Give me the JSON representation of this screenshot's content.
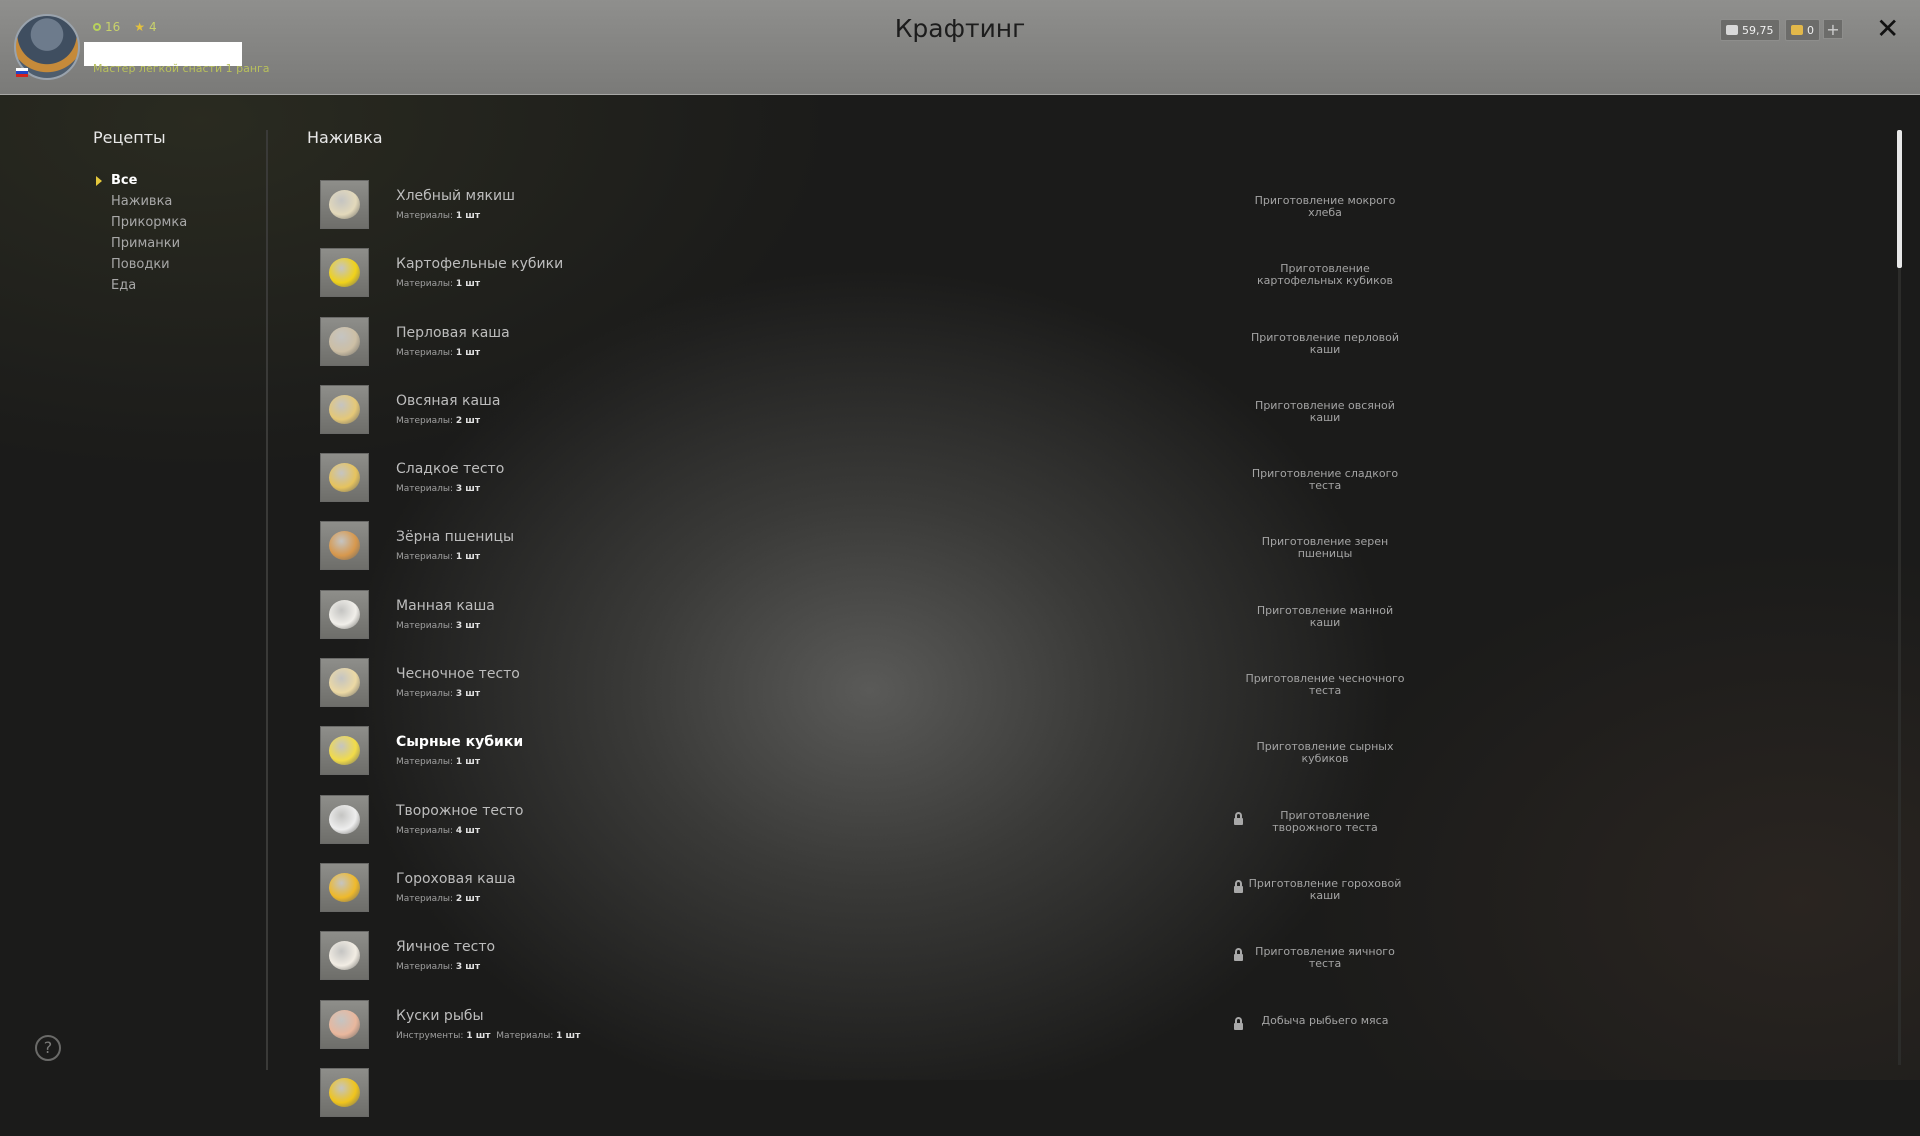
{
  "header": {
    "title": "Крафтинг",
    "level": "16",
    "stars": "4",
    "rank": "Мастер легкой снасти 1 ранга",
    "currency_silver": "59,75",
    "currency_gold": "0",
    "add_label": "+",
    "close_label": "✕"
  },
  "nav": {
    "title": "Рецепты",
    "items": [
      {
        "label": "Все"
      },
      {
        "label": "Наживка"
      },
      {
        "label": "Прикормка"
      },
      {
        "label": "Приманки"
      },
      {
        "label": "Поводки"
      },
      {
        "label": "Еда"
      }
    ]
  },
  "section_title": "Наживка",
  "recipes": [
    {
      "name": "Хлебный мякиш",
      "mat_label": "Материалы:",
      "mat_value": "1 шт",
      "desc": "Приготовление мокрого хлеба",
      "color": "#e3d9bb"
    },
    {
      "name": "Картофельные кубики",
      "mat_label": "Материалы:",
      "mat_value": "1 шт",
      "desc": "Приготовление картофельных кубиков",
      "color": "#f0d21a"
    },
    {
      "name": "Перловая каша",
      "mat_label": "Материалы:",
      "mat_value": "1 шт",
      "desc": "Приготовление перловой каши",
      "color": "#cdbfa5"
    },
    {
      "name": "Овсяная каша",
      "mat_label": "Материалы:",
      "mat_value": "2 шт",
      "desc": "Приготовление овсяной каши",
      "color": "#e5c877"
    },
    {
      "name": "Сладкое тесто",
      "mat_label": "Материалы:",
      "mat_value": "3 шт",
      "desc": "Приготовление сладкого теста",
      "color": "#e6c35d"
    },
    {
      "name": "Зёрна пшеницы",
      "mat_label": "Материалы:",
      "mat_value": "1 шт",
      "desc": "Приготовление зерен пшеницы",
      "color": "#d7984d"
    },
    {
      "name": "Манная каша",
      "mat_label": "Материалы:",
      "mat_value": "3 шт",
      "desc": "Приготовление манной каши",
      "color": "#f1efea"
    },
    {
      "name": "Чесночное тесто",
      "mat_label": "Материалы:",
      "mat_value": "3 шт",
      "desc": "Приготовление чесночного теста",
      "color": "#ecd9a4"
    },
    {
      "name": "Сырные кубики",
      "mat_label": "Материалы:",
      "mat_value": "1 шт",
      "desc": "Приготовление сырных кубиков",
      "color": "#f2dc48",
      "bright": true
    },
    {
      "name": "Творожное тесто",
      "mat_label": "Материалы:",
      "mat_value": "4 шт",
      "desc": "Приготовление творожного теста",
      "color": "#eeeeee",
      "locked": true
    },
    {
      "name": "Гороховая каша",
      "mat_label": "Материалы:",
      "mat_value": "2 шт",
      "desc": "Приготовление гороховой каши",
      "color": "#efb92a",
      "locked": true
    },
    {
      "name": "Яичное тесто",
      "mat_label": "Материалы:",
      "mat_value": "3 шт",
      "desc": "Приготовление яичного теста",
      "color": "#f2ede4",
      "locked": true
    },
    {
      "name": "Куски рыбы",
      "tool_label": "Инструменты:",
      "tool_value": "1 шт",
      "mat_label": "Материалы:",
      "mat_value": "1 шт",
      "desc": "Добыча рыбьего мяса",
      "color": "#e9b79d",
      "locked": true
    },
    {
      "name": "",
      "mat_label": "",
      "mat_value": "",
      "desc": "",
      "color": "#f0c41c"
    }
  ],
  "help_label": "?"
}
